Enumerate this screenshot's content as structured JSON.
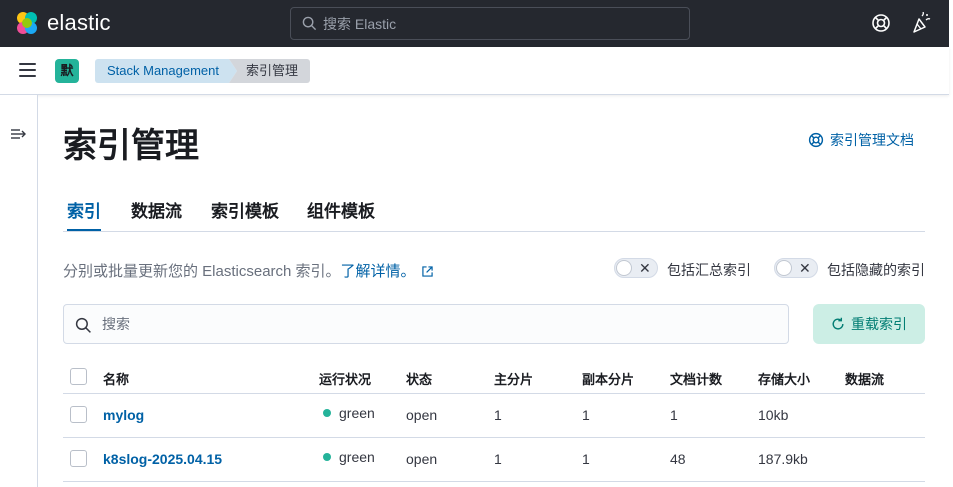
{
  "header": {
    "brand": "elastic",
    "search_placeholder": "搜索 Elastic"
  },
  "breadcrumbs": {
    "space_initial": "默",
    "items": [
      "Stack Management",
      "索引管理"
    ]
  },
  "page": {
    "title": "索引管理",
    "doc_link": "索引管理文档",
    "tabs": [
      "索引",
      "数据流",
      "索引模板",
      "组件模板"
    ],
    "active_tab": 0,
    "description": "分别或批量更新您的 Elasticsearch 索引。",
    "learn_more": "了解详情。",
    "toggles": [
      {
        "label": "包括汇总索引",
        "on": false
      },
      {
        "label": "包括隐藏的索引",
        "on": false
      }
    ],
    "search_placeholder": "搜索",
    "reload_label": "重载索引"
  },
  "table": {
    "columns": [
      "名称",
      "运行状况",
      "状态",
      "主分片",
      "副本分片",
      "文档计数",
      "存储大小",
      "数据流"
    ],
    "rows": [
      {
        "name": "mylog",
        "health": "green",
        "status": "open",
        "primaries": "1",
        "replicas": "1",
        "docs": "1",
        "size": "10kb",
        "data_stream": ""
      },
      {
        "name": "k8slog-2025.04.15",
        "health": "green",
        "status": "open",
        "primaries": "1",
        "replicas": "1",
        "docs": "48",
        "size": "187.9kb",
        "data_stream": ""
      }
    ]
  },
  "colors": {
    "header_bg": "#25282f",
    "link": "#0061a6",
    "health_green": "#24b39a",
    "reload_bg": "#cceee5"
  }
}
